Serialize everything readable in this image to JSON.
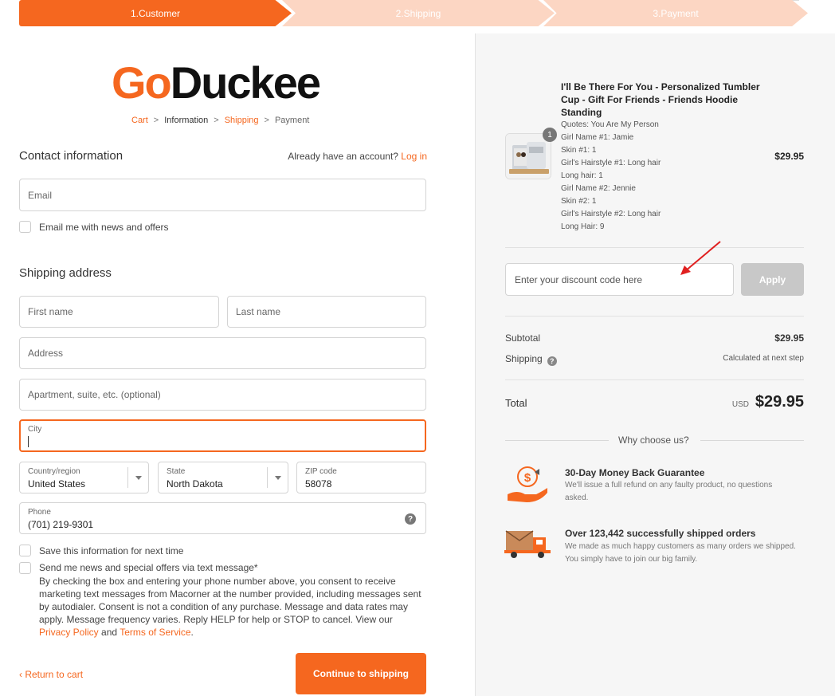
{
  "steps": [
    "1.Customer",
    "2.Shipping",
    "3.Payment"
  ],
  "logo": {
    "go": "Go",
    "duckee": "Duckee"
  },
  "breadcrumb": {
    "cart": "Cart",
    "information": "Information",
    "shipping": "Shipping",
    "payment": "Payment",
    "sep": ">"
  },
  "contact": {
    "title": "Contact information",
    "account_prompt": "Already have an account?",
    "login": "Log in",
    "email_placeholder": "Email",
    "news_label": "Email me with news and offers"
  },
  "shipping": {
    "title": "Shipping address",
    "first_name": "First name",
    "last_name": "Last name",
    "address": "Address",
    "apartment": "Apartment, suite, etc. (optional)",
    "city_label": "City",
    "country_label": "Country/region",
    "country_value": "United States",
    "state_label": "State",
    "state_value": "North Dakota",
    "zip_label": "ZIP code",
    "zip_value": "58078",
    "phone_label": "Phone",
    "phone_value": "(701) 219-9301",
    "help": "?"
  },
  "checks": {
    "save_info": "Save this information for next time",
    "sms_title": "Send me news and special offers via text message*",
    "consent": "By checking the box and entering your phone number above, you consent to receive marketing text messages from Macorner at the number provided, including messages sent by autodialer. Consent is not a condition of any purchase. Message and data rates may apply. Message frequency varies. Reply HELP for help or STOP to cancel. View our",
    "privacy": "Privacy Policy",
    "and": "and",
    "terms": "Terms of Service",
    "period": "."
  },
  "footer": {
    "return": "‹ Return to cart",
    "continue": "Continue to shipping"
  },
  "order": {
    "qty": "1",
    "title": "I'll Be There For You - Personalized Tumbler Cup - Gift For Friends - Friends Hoodie Standing",
    "options": [
      "Quotes: You Are My Person",
      "Girl Name #1: Jamie",
      "Skin #1: 1",
      "Girl's Hairstyle #1: Long hair",
      "Long hair: 1",
      "Girl Name #2: Jennie",
      "Skin #2: 1",
      "Girl's Hairstyle #2: Long hair",
      "Long Hair: 9"
    ],
    "price": "$29.95"
  },
  "discount": {
    "placeholder": "Enter your discount code here",
    "apply": "Apply"
  },
  "summary": {
    "subtotal_label": "Subtotal",
    "subtotal_value": "$29.95",
    "shipping_label": "Shipping",
    "shipping_value": "Calculated at next step",
    "total_label": "Total",
    "currency": "USD",
    "total_value": "$29.95"
  },
  "why": {
    "title": "Why choose us?",
    "features": [
      {
        "title": "30-Day Money Back Guarantee",
        "desc": "We'll issue a full refund on any faulty product, no questions asked."
      },
      {
        "title": "Over 123,442 successfully shipped orders",
        "desc": "We made as much happy customers as many orders we shipped. You simply have to join our big family."
      }
    ]
  },
  "colors": {
    "accent": "#f5671f",
    "step_inactive": "#fcd6c3",
    "annotation_arrow": "#e02020"
  }
}
